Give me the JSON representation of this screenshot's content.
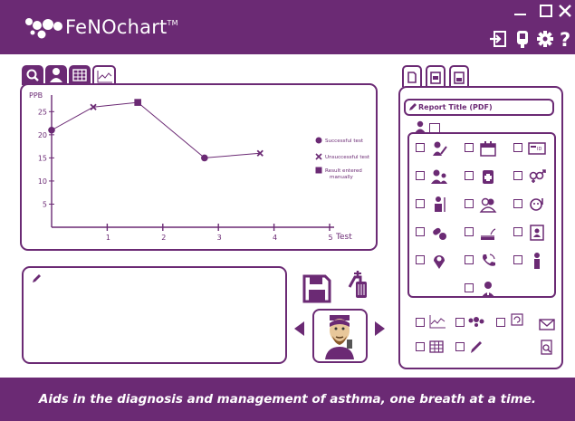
{
  "app": {
    "name": "FeNOchart",
    "trademark": "TM",
    "footer_tagline": "Aids in the diagnosis and management of asthma, one breath at a time."
  },
  "colors": {
    "brand": "#6b2a74",
    "background": "#ffffff"
  },
  "window_controls": [
    "minimize-icon",
    "maximize-icon",
    "close-icon"
  ],
  "header_icons": [
    "logout-icon",
    "device-icon",
    "gear-icon",
    "help-icon"
  ],
  "left_tabs": [
    "search-icon",
    "user-icon",
    "table-icon",
    "chart-icon"
  ],
  "right_tabs": [
    "document-icon",
    "pdf-icon",
    "printer-icon"
  ],
  "chart_data": {
    "type": "line",
    "ylabel": "PPB",
    "xlabel": "Test",
    "y_ticks": [
      "25",
      "20",
      "15",
      "10",
      "5"
    ],
    "x_ticks": [
      "1",
      "2",
      "3",
      "4",
      "5"
    ],
    "ylim": [
      0,
      28
    ],
    "xlim": [
      0,
      5
    ],
    "series": [
      {
        "points": [
          {
            "x": 0,
            "y": 21,
            "marker": "circle"
          },
          {
            "x": 0.75,
            "y": 26,
            "marker": "x"
          },
          {
            "x": 1.55,
            "y": 27,
            "marker": "square"
          },
          {
            "x": 2.75,
            "y": 15,
            "marker": "circle"
          },
          {
            "x": 3.75,
            "y": 16,
            "marker": "x"
          }
        ]
      }
    ],
    "legend": [
      {
        "marker": "circle",
        "label": "Successful test"
      },
      {
        "marker": "x",
        "label": "Unsuccessful test"
      },
      {
        "marker": "square",
        "label": "Result entered manually"
      }
    ],
    "legend_placement": "right"
  },
  "report": {
    "title_placeholder": "Report Title (PDF)",
    "grid_icons": [
      "patient-signature-icon",
      "calendar-icon",
      "id-card-icon",
      "patients-icon",
      "medical-history-icon",
      "gender-icon",
      "height-icon",
      "ethnicity-icon",
      "age-icon",
      "medication-icon",
      "smoking-icon",
      "doctor-card-icon",
      "location-icon",
      "phone-icon",
      "physician-icon",
      "operator-icon"
    ],
    "footer_icons": [
      "chart-icon",
      "logo-icon",
      "refresh-icon",
      "email-icon",
      "table-icon",
      "pen-icon",
      "search-document-icon"
    ]
  },
  "actions": [
    "save-icon",
    "measure-device-icon",
    "previous-arrow",
    "next-arrow",
    "avatar-icon"
  ]
}
